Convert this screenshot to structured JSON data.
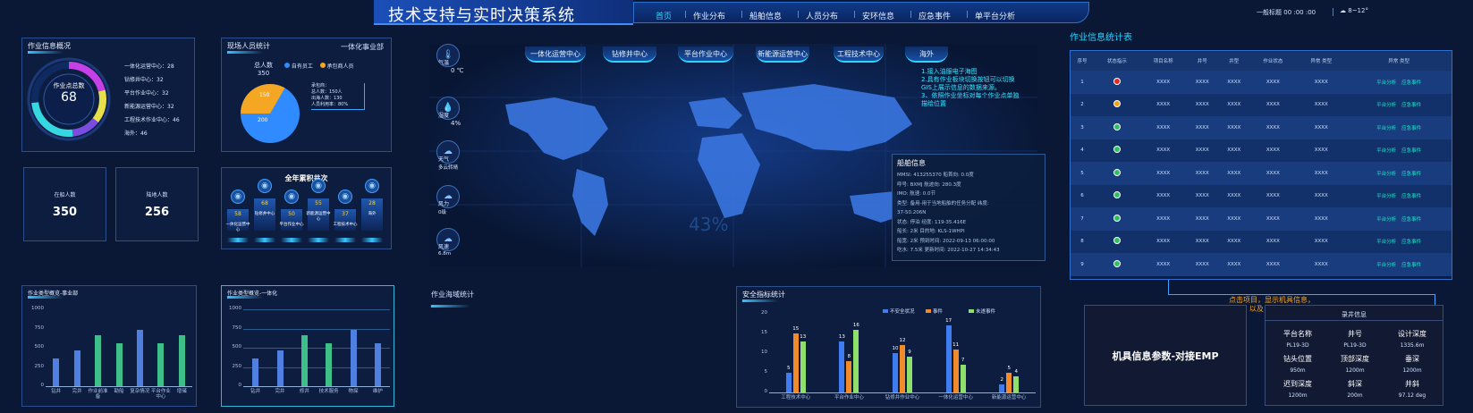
{
  "header": {
    "title": "技术支持与实时决策系统",
    "nav": [
      "首页",
      "作业分布",
      "船舶信息",
      "人员分布",
      "安环信息",
      "应急事件",
      "单平台分析"
    ],
    "right_label": "一般标题",
    "right_time": "00 :00 :00",
    "weather": "8~12°"
  },
  "overview": {
    "title": "作业信息概况",
    "center_label": "作业点总数",
    "center_value": "68",
    "items": [
      "一体化运营中心：28",
      "钻修井中心：32",
      "平台作业中心：32",
      "新能源运营中心：32",
      "工程技术作业中心：46",
      "海外：46"
    ]
  },
  "onsite": {
    "title": "现场人员统计",
    "dept": "一体化事业部",
    "total_label": "总人数",
    "total_value": "350",
    "legend": [
      "自有员工",
      "承包商人员"
    ],
    "pie_values": [
      "150",
      "200"
    ],
    "callout": [
      "承包商：",
      "总人数：150人",
      "出海人数：130",
      "人员利用率：80%"
    ]
  },
  "counts": {
    "onboard_label": "在船人数",
    "onboard_value": "350",
    "onshore_label": "陆地人数",
    "onshore_value": "256"
  },
  "wells": {
    "title": "全年累积井次",
    "items": [
      {
        "value": "58",
        "label": "一体化运营中心"
      },
      {
        "value": "68",
        "label": "钻修井中心"
      },
      {
        "value": "50",
        "label": "平台作业中心"
      },
      {
        "value": "55",
        "label": "新能源运营中心"
      },
      {
        "value": "37",
        "label": "工程技术中心"
      },
      {
        "value": "28",
        "label": "海外"
      }
    ]
  },
  "map": {
    "tabs": [
      "一体化运营中心",
      "钻修井中心",
      "平台作业中心",
      "新能源运营中心",
      "工程技术中心",
      "海外"
    ],
    "notes": [
      "1.接入油服电子海图",
      "2.具有作业板块切换按钮可以切换GIS上展示信息的数据来源。",
      "3、依照作业坐标对每个作业点单独描绘位置"
    ],
    "watermark": "43%",
    "sidebar": [
      {
        "icon": "🌡",
        "label": "气温",
        "value": "0 ℃"
      },
      {
        "icon": "💧",
        "label": "湿度",
        "value": "4%"
      },
      {
        "icon": "☁",
        "label": "天气",
        "value": "多云转晴"
      },
      {
        "icon": "☁",
        "label": "风力",
        "value": "0级"
      },
      {
        "icon": "☁",
        "label": "风速",
        "value": "6.8m"
      }
    ]
  },
  "ship": {
    "title": "船舶信息",
    "rows": [
      "MMSI:    413255370    船首向:    0.0度",
      "呼号:    BXMJ   航迹向:    280.3度",
      "IMO:           航速:    0.0节",
      "类型:    备用-用于当地船舶的任务分配   纬度:",
      "37-50.206N",
      "状态:    停泊    经度:    119-35.416E",
      "船长:    2米    目的地:    KLS-1WHPI",
      "船宽:    2米    预到时间:    2022-09-13 06:00:00",
      "吃水:    7.5米    更新时间:    2022-10-27 14:34:43"
    ]
  },
  "stats_table": {
    "title": "作业信息统计表",
    "headers": [
      "序号",
      "状态指示",
      "项目名称",
      "井号",
      "井型",
      "作业状态",
      "异常 类型",
      "异常 类型"
    ],
    "rows": [
      {
        "no": "1",
        "color": "#e02b2b"
      },
      {
        "no": "2",
        "color": "#f0a020"
      },
      {
        "no": "3",
        "color": "#2fbf60"
      },
      {
        "no": "4",
        "color": "#2fbf60"
      },
      {
        "no": "5",
        "color": "#2fbf60"
      },
      {
        "no": "6",
        "color": "#2fbf60"
      },
      {
        "no": "7",
        "color": "#2fbf60"
      },
      {
        "no": "8",
        "color": "#2fbf60"
      },
      {
        "no": "9",
        "color": "#2fbf60"
      }
    ],
    "cell": "XXXX",
    "link1": "平台分析",
    "link2": "应急事件"
  },
  "hint": "点击项目，显示机具信息，以及 录井信息",
  "emp_box": "机具信息参数-对接EMP",
  "logging": {
    "title": "录井信息",
    "items": [
      {
        "k": "平台名称",
        "v": "PL19-3D"
      },
      {
        "k": "井号",
        "v": "PL19-3D"
      },
      {
        "k": "设计深度",
        "v": "1335.6m"
      },
      {
        "k": "钻头位置",
        "v": "950m"
      },
      {
        "k": "顶部深度",
        "v": "1200m"
      },
      {
        "k": "垂深",
        "v": "1200m"
      },
      {
        "k": "迟到深度",
        "v": "1200m"
      },
      {
        "k": "斜深",
        "v": "200m"
      },
      {
        "k": "井斜",
        "v": "97.12 deg"
      }
    ]
  },
  "sea_area": {
    "title": "作业海域统计"
  },
  "chart_data": [
    {
      "type": "bar",
      "title": "作业类型概览-事业部",
      "categories": [
        "钻井",
        "完井",
        "作业前准备",
        "勘船",
        "复杂情况",
        "平台作业中心",
        "增储"
      ],
      "values": [
        360,
        460,
        660,
        560,
        730,
        560,
        660
      ],
      "ylim": [
        0,
        1000
      ],
      "yticks": [
        0,
        250,
        500,
        750,
        1000
      ],
      "colors": [
        "#4f7fe0",
        "#4f7fe0",
        "#3ebf8a",
        "#3ebf8a",
        "#4f7fe0",
        "#3ebf8a",
        "#3ebf8a"
      ]
    },
    {
      "type": "bar",
      "title": "作业类型概览-一体化",
      "categories": [
        "钻井",
        "完井",
        "修井",
        "技术服务",
        "物探",
        "维护"
      ],
      "values": [
        360,
        460,
        660,
        560,
        730,
        560
      ],
      "ylim": [
        0,
        1000
      ],
      "yticks": [
        0,
        250,
        500,
        750,
        1000
      ],
      "colors": [
        "#4f7fe0",
        "#4f7fe0",
        "#3ebf8a",
        "#3ebf8a",
        "#4f7fe0",
        "#4f7fe0"
      ]
    },
    {
      "type": "bar",
      "title": "安全指标统计",
      "categories": [
        "工程技术中心",
        "平台作业中心",
        "钻修井作业中心",
        "一体化运营中心",
        "新能源运营中心"
      ],
      "ylim": [
        0,
        20
      ],
      "yticks": [
        0,
        5,
        10,
        15,
        20
      ],
      "series": [
        {
          "name": "不安全状况",
          "color": "#3f7cf0",
          "values": [
            5,
            13,
            10,
            17,
            2
          ]
        },
        {
          "name": "事件",
          "color": "#f08a2a",
          "values": [
            15,
            8,
            12,
            11,
            5
          ]
        },
        {
          "name": "未遂事件",
          "color": "#8ee06a",
          "values": [
            13,
            16,
            9,
            7,
            4
          ]
        }
      ]
    }
  ]
}
